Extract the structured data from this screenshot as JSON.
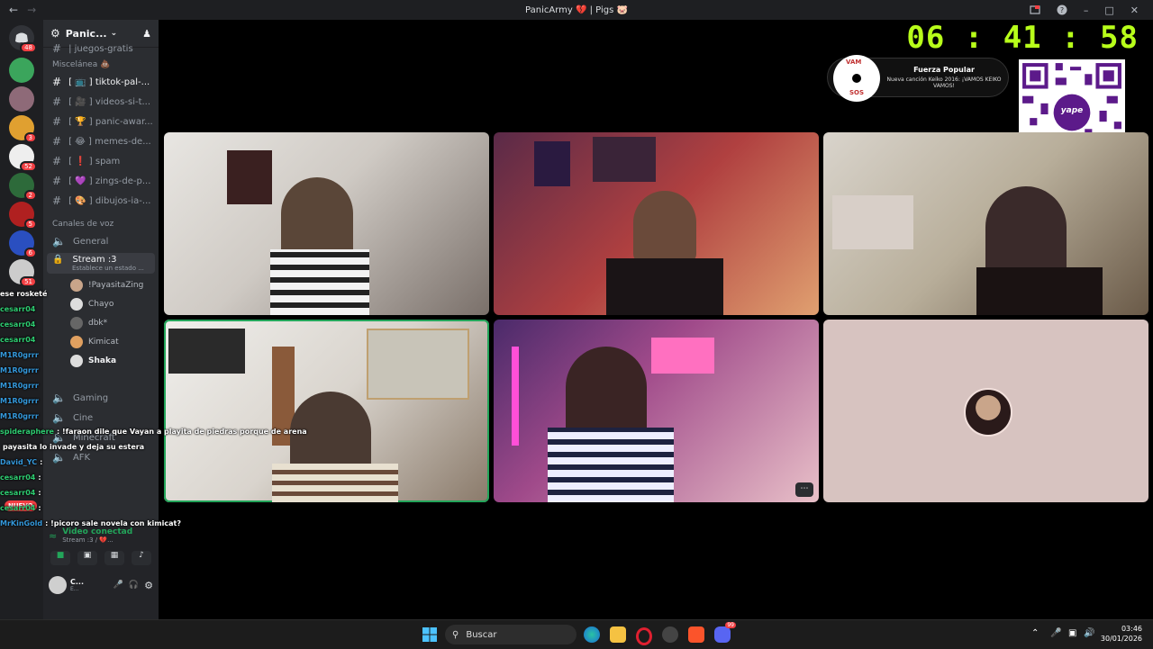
{
  "window": {
    "title": "PanicArmy 💔 | Pigs 🐷",
    "nav_back": "←",
    "nav_forward": "→"
  },
  "servers": [
    {
      "badge": "48"
    },
    {
      "badge": ""
    },
    {
      "badge": ""
    },
    {
      "badge": "3"
    },
    {
      "badge": "52"
    },
    {
      "badge": "2"
    },
    {
      "badge": "5"
    },
    {
      "badge": "6"
    },
    {
      "badge": "51"
    }
  ],
  "guild": {
    "name": "Panic...",
    "partial_top_channel": "| juegos-gratis",
    "category_misc": "Miscelánea 💩",
    "channels": [
      {
        "label": "[ 📺 ] tiktok-pal-...",
        "active": true
      },
      {
        "label": "[ 🎥 ] videos-si-t...",
        "active": false
      },
      {
        "label": "[ 🏆 ] panic-awar...",
        "active": false
      },
      {
        "label": "[ 😂 ] memes-de...",
        "active": false
      },
      {
        "label": "[ ❗ ] spam",
        "active": false
      },
      {
        "label": "[ 💜 ] zings-de-p...",
        "active": false
      },
      {
        "label": "[ 🎨 ] dibujos-ia-...",
        "active": false
      }
    ],
    "category_voice": "Canales de voz",
    "voice_general": "General",
    "voice_stream": "Stream :3",
    "voice_stream_status": "Establece un estado ...",
    "voice_members": [
      "!PayasitaZing",
      "Chayo",
      "dbk*",
      "Kimicat",
      "Shaka"
    ],
    "voice_gaming": "Gaming",
    "voice_cine": "Cine",
    "voice_minecraft": "Minecraft",
    "voice_afk": "AFK"
  },
  "voice_panel": {
    "status": "Video conectad",
    "channel": "Stream :3 / 💔...",
    "user_initial": "C...",
    "user_sub": "E..."
  },
  "overlay": {
    "clock": "06 : 41 : 58",
    "song_title": "Fuerza Popular",
    "song_sub": "Nueva canción Keiko 2016: ¡VAMOS KEIKO VAMOS!",
    "disc_text_top": "VAM",
    "disc_text_bottom": "SOS",
    "qr_label": "yape"
  },
  "chat": [
    {
      "user": "ese rosketé",
      "msg": "",
      "color": "#ffffff"
    },
    {
      "user": "cesarr04",
      "msg": "",
      "color": "#2ecc71"
    },
    {
      "user": "cesarr04",
      "msg": "",
      "color": "#2ecc71"
    },
    {
      "user": "cesarr04",
      "msg": "",
      "color": "#2ecc71"
    },
    {
      "user": "M1R0grrr",
      "msg": "",
      "color": "#3498db"
    },
    {
      "user": "M1R0grrr",
      "msg": "",
      "color": "#3498db"
    },
    {
      "user": "M1R0grrr",
      "msg": "",
      "color": "#3498db"
    },
    {
      "user": "M1R0grrr",
      "msg": "",
      "color": "#3498db"
    },
    {
      "user": "M1R0grrr",
      "msg": "",
      "color": "#3498db"
    },
    {
      "user": "spideraphere",
      "msg": ": !faraon dile que Vayan a playita de piedras porque de arena",
      "color": "#2ecc71"
    },
    {
      "user": "",
      "msg": "payasita lo invade y deja su estera",
      "color": "#ffffff"
    },
    {
      "user": "David_YC",
      "msg": ":",
      "color": "#3498db"
    },
    {
      "user": "cesarr04",
      "msg": ":",
      "color": "#2ecc71"
    },
    {
      "user": "cesarr04",
      "msg": ":",
      "color": "#2ecc71"
    },
    {
      "user": "cesarr04",
      "msg": ":",
      "color": "#2ecc71"
    },
    {
      "user": "MrKinGold",
      "msg": ": !picoro sale novela con kimicat?",
      "color": "#3498db"
    }
  ],
  "new_badge": "NUEVO",
  "taskbar": {
    "search_label": "Buscar",
    "time": "03:46",
    "date": "30/01/2026",
    "discord_badge": "99"
  },
  "colors": {
    "accent_green": "#23a55a",
    "clock_green": "#b8ff1a",
    "badge_red": "#f23f43"
  }
}
